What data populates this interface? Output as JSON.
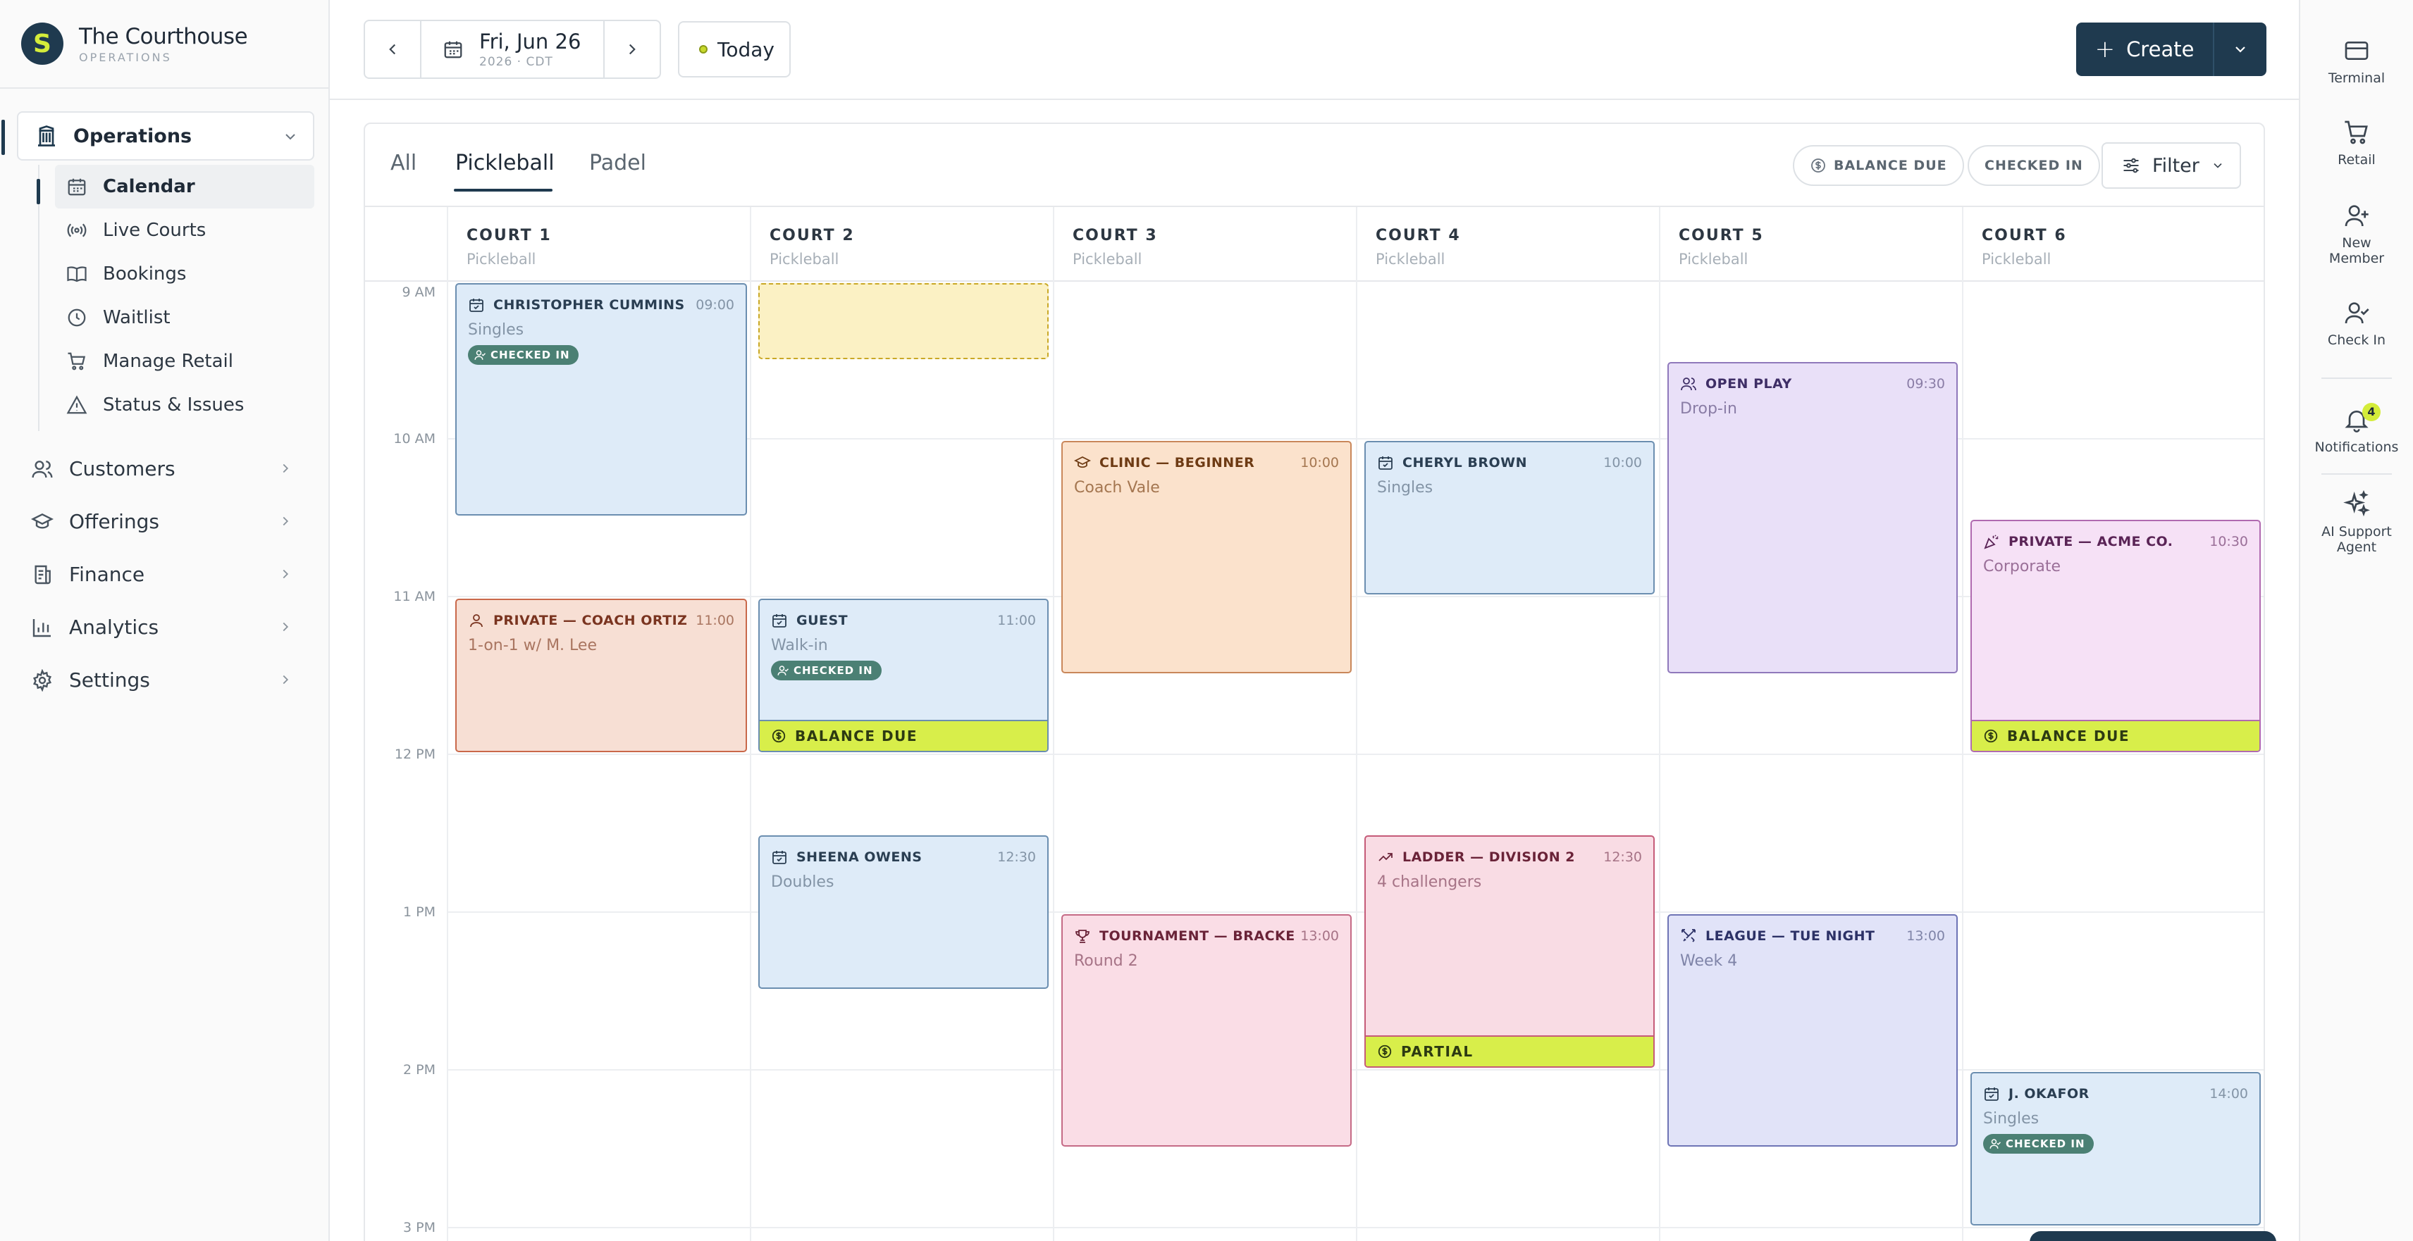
{
  "brand": {
    "name": "The Courthouse",
    "sub": "OPERATIONS",
    "logo_letter": "S"
  },
  "sidebar": {
    "operations_label": "Operations",
    "sub_items": [
      {
        "label": "Calendar",
        "icon": "calendar-icon",
        "active": true
      },
      {
        "label": "Live Courts",
        "icon": "broadcast-icon"
      },
      {
        "label": "Bookings",
        "icon": "book-icon"
      },
      {
        "label": "Waitlist",
        "icon": "clock-icon"
      },
      {
        "label": "Manage Retail",
        "icon": "cart-icon"
      },
      {
        "label": "Status & Issues",
        "icon": "warning-icon"
      }
    ],
    "main_items": [
      {
        "label": "Customers",
        "icon": "users-icon"
      },
      {
        "label": "Offerings",
        "icon": "graduation-cap-icon"
      },
      {
        "label": "Finance",
        "icon": "receipt-icon"
      },
      {
        "label": "Analytics",
        "icon": "bar-chart-icon"
      },
      {
        "label": "Settings",
        "icon": "gear-icon"
      }
    ]
  },
  "topbar": {
    "date_main": "Fri, Jun 26",
    "date_sub": "2026 · CDT",
    "today_label": "Today",
    "create_label": "Create"
  },
  "rail": {
    "items": [
      {
        "label": "Terminal",
        "icon": "card-icon"
      },
      {
        "label": "Retail",
        "icon": "cart-icon"
      },
      {
        "label": "New Member",
        "icon": "user-plus-icon"
      },
      {
        "label": "Check In",
        "icon": "user-check-icon"
      },
      {
        "label": "Notifications",
        "icon": "bell-icon",
        "badge": "4"
      },
      {
        "label": "AI Support Agent",
        "icon": "sparkle-icon"
      }
    ]
  },
  "calendar": {
    "tabs": [
      "All",
      "Pickleball",
      "Padel"
    ],
    "active_tab": "Pickleball",
    "chips": {
      "balance_due": "BALANCE DUE",
      "checked_in": "CHECKED IN"
    },
    "filter_label": "Filter",
    "courts": [
      {
        "name": "COURT 1",
        "sport": "Pickleball"
      },
      {
        "name": "COURT 2",
        "sport": "Pickleball"
      },
      {
        "name": "COURT 3",
        "sport": "Pickleball"
      },
      {
        "name": "COURT 4",
        "sport": "Pickleball"
      },
      {
        "name": "COURT 5",
        "sport": "Pickleball"
      },
      {
        "name": "COURT 6",
        "sport": "Pickleball"
      }
    ],
    "times": [
      "9 AM",
      "10 AM",
      "11 AM",
      "12 PM",
      "1 PM",
      "2 PM",
      "3 PM"
    ],
    "events": [
      {
        "court": 1,
        "title": "CHRISTOPHER CUMMINS",
        "time": "09:00",
        "sub": "Singles",
        "badge": "CHECKED IN",
        "color": "blue",
        "icon": "calendar-check-icon"
      },
      {
        "court": 1,
        "title": "PRIVATE — COACH ORTIZ",
        "time": "11:00",
        "sub": "1-on-1 w/ M. Lee",
        "color": "salmon",
        "icon": "user-icon"
      },
      {
        "court": 2,
        "title": "GUEST",
        "time": "11:00",
        "sub": "Walk-in",
        "badge": "CHECKED IN",
        "footer": "BALANCE DUE",
        "color": "blue",
        "icon": "calendar-check-icon"
      },
      {
        "court": 2,
        "title": "SHEENA OWENS",
        "time": "12:30",
        "sub": "Doubles",
        "color": "blue",
        "icon": "calendar-check-icon"
      },
      {
        "court": 3,
        "title": "CLINIC — BEGINNER",
        "time": "10:00",
        "sub": "Coach Vale",
        "color": "orange",
        "icon": "graduation-cap-icon"
      },
      {
        "court": 3,
        "title": "TOURNAMENT — BRACKET B",
        "time": "13:00",
        "sub": "Round 2",
        "color": "pink",
        "icon": "trophy-icon"
      },
      {
        "court": 4,
        "title": "CHERYL BROWN",
        "time": "10:00",
        "sub": "Singles",
        "color": "blue",
        "icon": "calendar-check-icon"
      },
      {
        "court": 4,
        "title": "LADDER — DIVISION 2",
        "time": "12:30",
        "sub": "4 challengers",
        "footer": "PARTIAL",
        "color": "rose",
        "icon": "trend-up-icon"
      },
      {
        "court": 5,
        "title": "OPEN PLAY",
        "time": "09:30",
        "sub": "Drop-in",
        "color": "purple",
        "icon": "users-icon"
      },
      {
        "court": 5,
        "title": "LEAGUE — TUE NIGHT",
        "time": "13:00",
        "sub": "Week 4",
        "color": "lavender",
        "icon": "swords-icon"
      },
      {
        "court": 6,
        "title": "PRIVATE — ACME CO.",
        "time": "10:30",
        "sub": "Corporate",
        "footer": "BALANCE DUE",
        "color": "magenta",
        "icon": "party-icon"
      },
      {
        "court": 6,
        "title": "J. OKAFOR",
        "time": "14:00",
        "sub": "Singles",
        "badge": "CHECKED IN",
        "color": "blue",
        "icon": "calendar-check-icon"
      }
    ]
  }
}
